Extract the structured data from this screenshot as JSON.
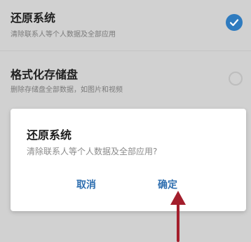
{
  "settings": {
    "items": [
      {
        "title": "还原系统",
        "subtitle": "清除联系人等个人数据及全部应用",
        "selected": true
      },
      {
        "title": "格式化存储盘",
        "subtitle": "删除存储盘全部数据，如图片和视频",
        "selected": false
      }
    ]
  },
  "dialog": {
    "title": "还原系统",
    "message": "清除联系人等个人数据及全部应用?",
    "cancel_label": "取消",
    "confirm_label": "确定"
  },
  "colors": {
    "accent": "#2f7bbf",
    "annotation_arrow": "#a31e2c"
  }
}
